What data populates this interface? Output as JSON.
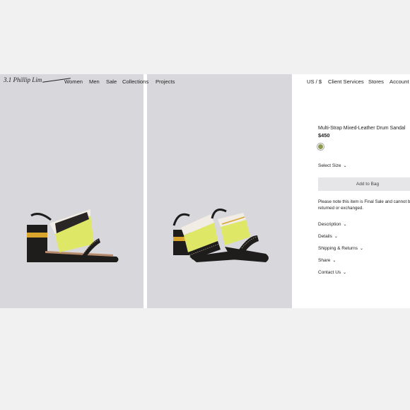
{
  "nav": {
    "logo": "3.1 Phillip Lim",
    "left_items": [
      "Women",
      "Men",
      "Sale",
      "Collections",
      "Projects"
    ],
    "right_items": [
      "US / $",
      "Client Services",
      "Stores",
      "Account"
    ]
  },
  "product": {
    "name": "Multi-Strap Mixed-Leather Drum Sandal",
    "price": "$450",
    "swatch_color": "#8c9a52",
    "size_label": "Select Size",
    "add_to_bag": "Add to Bag",
    "note": "Please note this item is Final Sale and cannot be returned or exchanged.",
    "accordion": [
      "Description",
      "Details",
      "Shipping & Returns",
      "Share",
      "Contact Us"
    ]
  },
  "colors": {
    "panel_bg": "#d8d8dc",
    "strap_yellow": "#dfe866",
    "leather_black": "#1f1c1c",
    "cream": "#f1ece4"
  },
  "icons": [
    "chevron-down-icon"
  ]
}
